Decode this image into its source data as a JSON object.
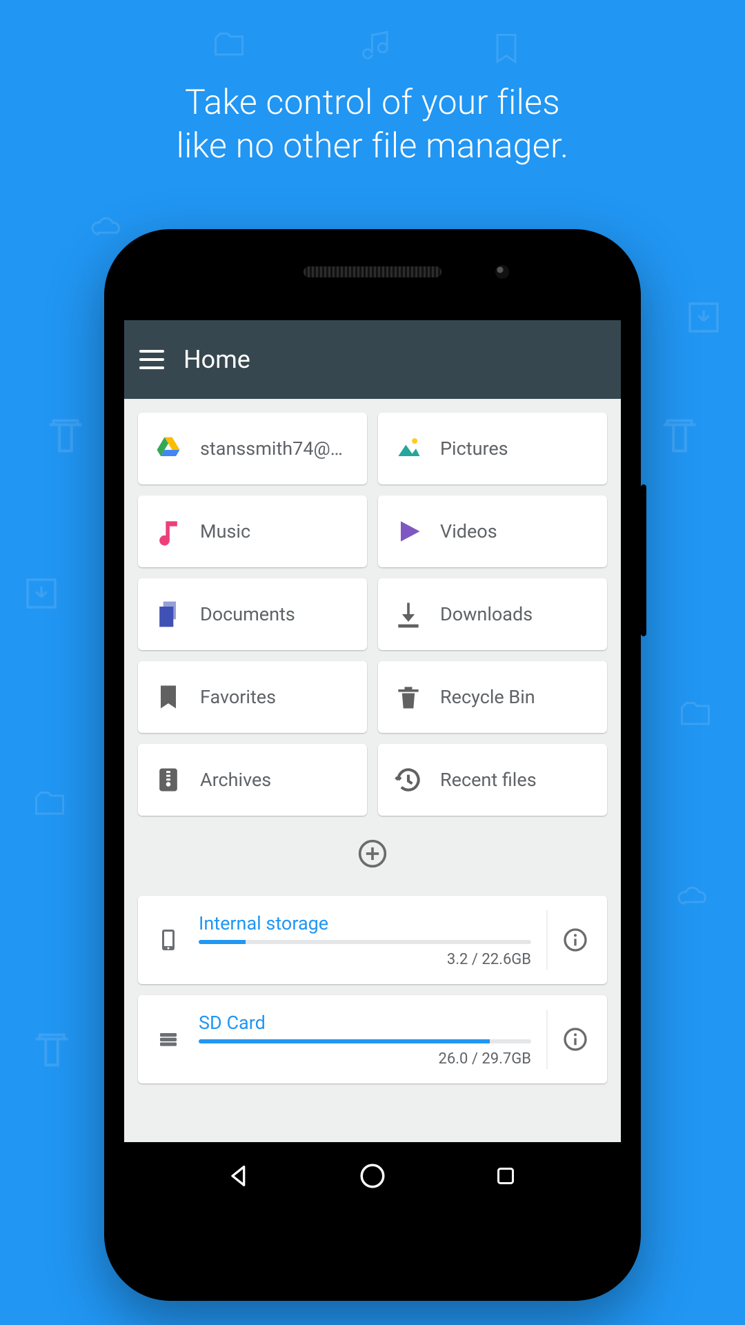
{
  "headline": "Take control of your files\nlike no other file manager.",
  "appbar": {
    "title": "Home"
  },
  "tiles": [
    {
      "name": "drive",
      "label": "stanssmith74@…",
      "icon": "google-drive"
    },
    {
      "name": "pictures",
      "label": "Pictures",
      "icon": "image"
    },
    {
      "name": "music",
      "label": "Music",
      "icon": "music-note"
    },
    {
      "name": "videos",
      "label": "Videos",
      "icon": "play"
    },
    {
      "name": "documents",
      "label": "Documents",
      "icon": "documents"
    },
    {
      "name": "downloads",
      "label": "Downloads",
      "icon": "download"
    },
    {
      "name": "favorites",
      "label": "Favorites",
      "icon": "bookmark"
    },
    {
      "name": "recycle-bin",
      "label": "Recycle Bin",
      "icon": "trash"
    },
    {
      "name": "archives",
      "label": "Archives",
      "icon": "zip"
    },
    {
      "name": "recent",
      "label": "Recent files",
      "icon": "history"
    }
  ],
  "storages": [
    {
      "name": "internal",
      "label": "Internal storage",
      "used": 3.2,
      "total": 22.6,
      "unit": "GB",
      "icon": "phone"
    },
    {
      "name": "sdcard",
      "label": "SD Card",
      "used": 26.0,
      "total": 29.7,
      "unit": "GB",
      "icon": "sd"
    }
  ],
  "icon_colors": {
    "google-drive": "#fbbc04",
    "image": "#26a69a",
    "music-note": "#ec407a",
    "play": "#7e57c2",
    "documents": "#3f51b5",
    "download": "#616161",
    "bookmark": "#616161",
    "trash": "#616161",
    "zip": "#616161",
    "history": "#616161"
  }
}
